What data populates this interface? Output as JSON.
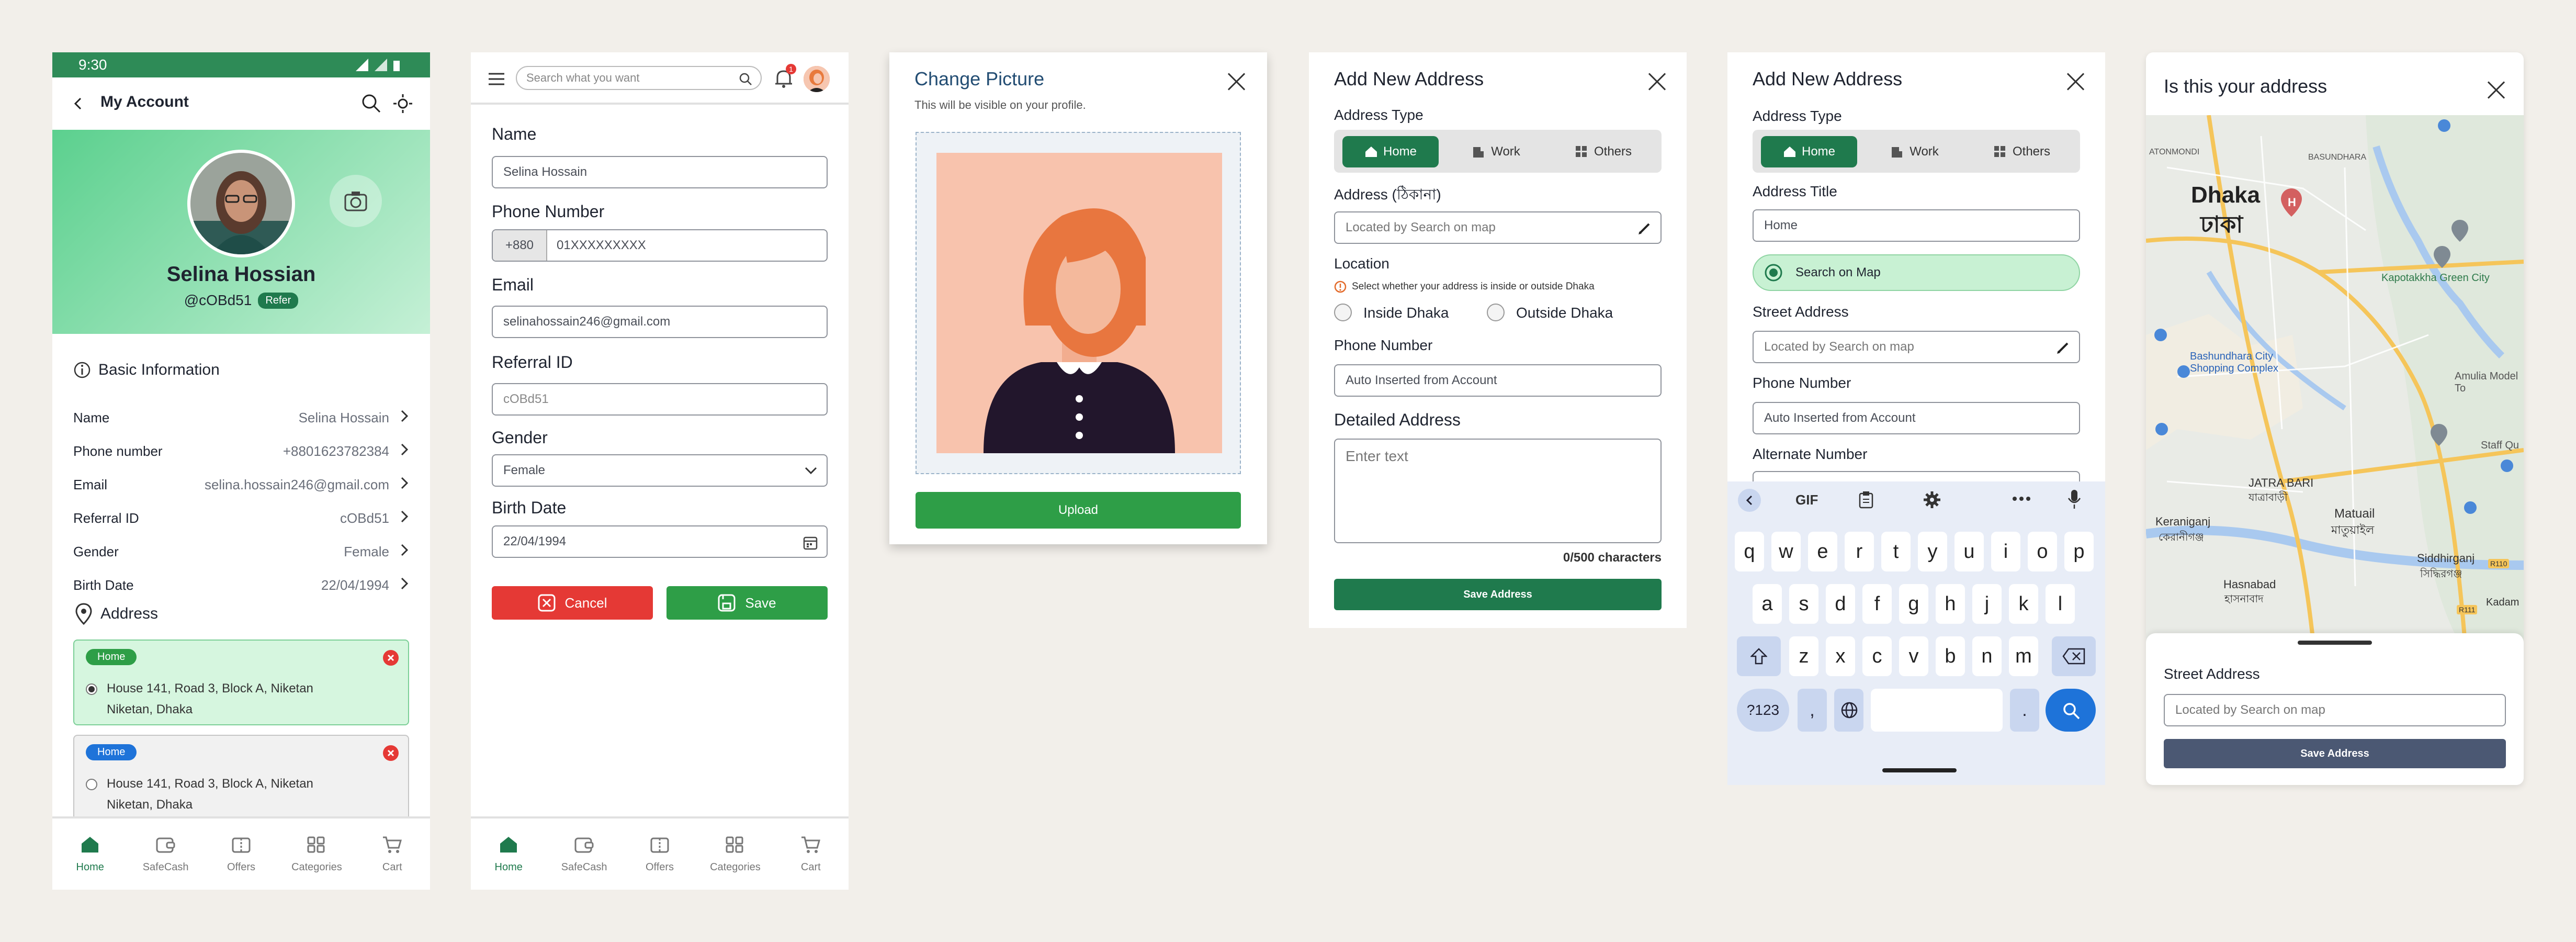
{
  "colors": {
    "brand_green": "#1f7a4d",
    "accent_green": "#2e9e47",
    "danger_red": "#e53935",
    "blue_pill": "#1e73d9",
    "background": "#f2efea"
  },
  "account": {
    "status_time": "9:30",
    "title": "My Account",
    "user_name": "Selina Hossian",
    "user_handle": "@cOBd51",
    "refer_badge": "Refer",
    "basic_info_title": "Basic Information",
    "info_rows": [
      {
        "label": "Name",
        "value": "Selina Hossain"
      },
      {
        "label": "Phone number",
        "value": "+8801623782384"
      },
      {
        "label": "Email",
        "value": "selina.hossain246@gmail.com"
      },
      {
        "label": "Referral ID",
        "value": "cOBd51"
      },
      {
        "label": "Gender",
        "value": "Female"
      },
      {
        "label": "Birth Date",
        "value": "22/04/1994"
      }
    ],
    "address_title": "Address",
    "addresses": [
      {
        "tag": "Home",
        "line1": "House 141, Road 3, Block A, Niketan",
        "line2": "Niketan, Dhaka",
        "selected": true
      },
      {
        "tag": "Home",
        "line1": "House 141, Road 3, Block A, Niketan",
        "line2": "Niketan, Dhaka",
        "selected": false
      }
    ]
  },
  "nav": {
    "items": [
      "Home",
      "SafeCash",
      "Offers",
      "Categories",
      "Cart"
    ]
  },
  "edit": {
    "search_placeholder": "Search what you want",
    "notif_count": "1",
    "name_label": "Name",
    "name_value": "Selina Hossain",
    "phone_label": "Phone Number",
    "phone_prefix": "+880",
    "phone_placeholder": "01XXXXXXXXX",
    "email_label": "Email",
    "email_value": "selinahossain246@gmail.com",
    "referral_label": "Referral ID",
    "referral_value": "cOBd51",
    "gender_label": "Gender",
    "gender_value": "Female",
    "birth_label": "Birth Date",
    "birth_value": "22/04/1994",
    "cancel_label": "Cancel",
    "save_label": "Save"
  },
  "picture": {
    "title": "Change Picture",
    "subtitle": "This will be visible on your profile.",
    "upload_label": "Upload"
  },
  "address_form": {
    "title": "Add New Address",
    "type_label": "Address Type",
    "types": [
      "Home",
      "Work",
      "Others"
    ],
    "address_label": "Address (ঠিকানা)",
    "address_placeholder": "Located by Search on map",
    "location_label": "Location",
    "location_hint": "Select whether your address is inside or outside Dhaka",
    "inside_label": "Inside Dhaka",
    "outside_label": "Outside Dhaka",
    "phone_label": "Phone Number",
    "phone_value": "Auto Inserted from Account",
    "detailed_label": "Detailed Address",
    "detailed_placeholder": "Enter text",
    "char_count": "0/500 characters",
    "save_label": "Save Address"
  },
  "address_form2": {
    "title": "Add New Address",
    "type_label": "Address Type",
    "types": [
      "Home",
      "Work",
      "Others"
    ],
    "title_label": "Address Title",
    "title_value": "Home",
    "search_map_label": "Search on Map",
    "street_label": "Street Address",
    "street_placeholder": "Located by Search on map",
    "phone_label": "Phone Number",
    "phone_value": "Auto Inserted from Account",
    "alt_label": "Alternate Number",
    "keyboard": {
      "toolbar": [
        "GIF"
      ],
      "row1": [
        "q",
        "w",
        "e",
        "r",
        "t",
        "y",
        "u",
        "i",
        "o",
        "p"
      ],
      "row2": [
        "a",
        "s",
        "d",
        "f",
        "g",
        "h",
        "j",
        "k",
        "l"
      ],
      "row3": [
        "z",
        "x",
        "c",
        "v",
        "b",
        "n",
        "m"
      ],
      "symbols_key": "?123",
      "comma_key": ",",
      "period_key": "."
    }
  },
  "map_confirm": {
    "title": "Is this your address",
    "map_labels": {
      "dhaka_en": "Dhaka",
      "dhaka_bn": "ঢাকা",
      "kapotakkha": "Kapotakkha Green City",
      "bashundhara": "Bashundhara City Shopping Complex",
      "amulia": "Amulia Model To",
      "jatrabari": "JATRA BARI",
      "jatrabari_bn": "যাত্রাবাড়ী",
      "matuail": "Matuail",
      "matuail_bn": "মাতুয়াইল",
      "keraniganj": "Keraniganj",
      "keraniganj_bn": "কেরানীগঞ্জ",
      "siddhirganj": "Siddhirganj",
      "siddhirganj_bn": "সিদ্ধিরগঞ্জ",
      "hasnabad": "Hasnabad",
      "hasnabad_bn": "হাসনাবাদ",
      "kadam": "Kadam",
      "staff_quarter": "Staff Qu",
      "basundhara_top": "BASUNDHARA",
      "tonmondi": "ATONMONDI",
      "r110": "R110",
      "r111": "R111"
    },
    "street_label": "Street Address",
    "street_placeholder": "Located by Search on map",
    "save_label": "Save Address"
  }
}
